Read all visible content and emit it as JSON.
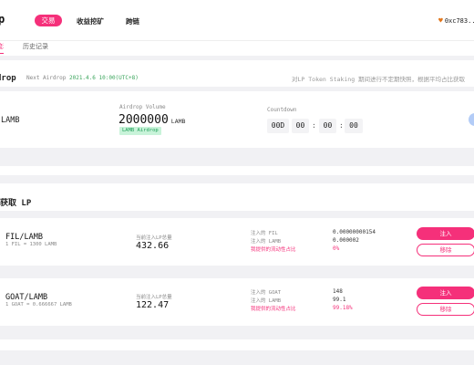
{
  "header": {
    "logo": "p",
    "nav": [
      "交易",
      "收益挖矿",
      "跨链"
    ],
    "wallet": "0xc783..."
  },
  "subtabs": {
    "active": "流动",
    "history": "历史记录"
  },
  "airdrop": {
    "title": "drop",
    "next_label": "Next Airdrop",
    "next_date": "2021.4.6 10:00(UTC+8)",
    "notice": "对LP Token Staking 期间进行不定期快照，根据平均占比获取",
    "token": "LAMB",
    "volume_label": "Airdrop Volume",
    "volume_value": "2000000",
    "volume_unit": "LAMB",
    "volume_tag": "LAMB Airdrop",
    "countdown_label": "Countdown",
    "countdown": {
      "days": "00D",
      "hours": "00",
      "minutes": "00",
      "seconds": "00"
    }
  },
  "lp_section_title": "获取 LP",
  "pools": [
    {
      "pair": "FIL/LAMB",
      "rate": "1 FIL = 1300 LAMB",
      "lp_label": "当前注入LP总量",
      "lp_value": "432.66",
      "info": [
        {
          "label": "注入的 FIL",
          "value": "0.00000000154"
        },
        {
          "label": "注入的 LAMB",
          "value": "0.000002"
        },
        {
          "label": "我提供的流动性占比",
          "value": "0%"
        }
      ],
      "inject": "注入",
      "remove": "移除"
    },
    {
      "pair": "GOAT/LAMB",
      "rate": "1 GOAT = 0.666667 LAMB",
      "lp_label": "当前注入LP总量",
      "lp_value": "122.47",
      "info": [
        {
          "label": "注入的 GOAT",
          "value": "148"
        },
        {
          "label": "注入的 LAMB",
          "value": "99.1"
        },
        {
          "label": "我提供的流动性占比",
          "value": "99.18%"
        }
      ],
      "inject": "注入",
      "remove": "移除"
    }
  ],
  "colors": {
    "accent": "#f5307a",
    "green": "#1f9e58",
    "blue": "#b3ccf7"
  }
}
